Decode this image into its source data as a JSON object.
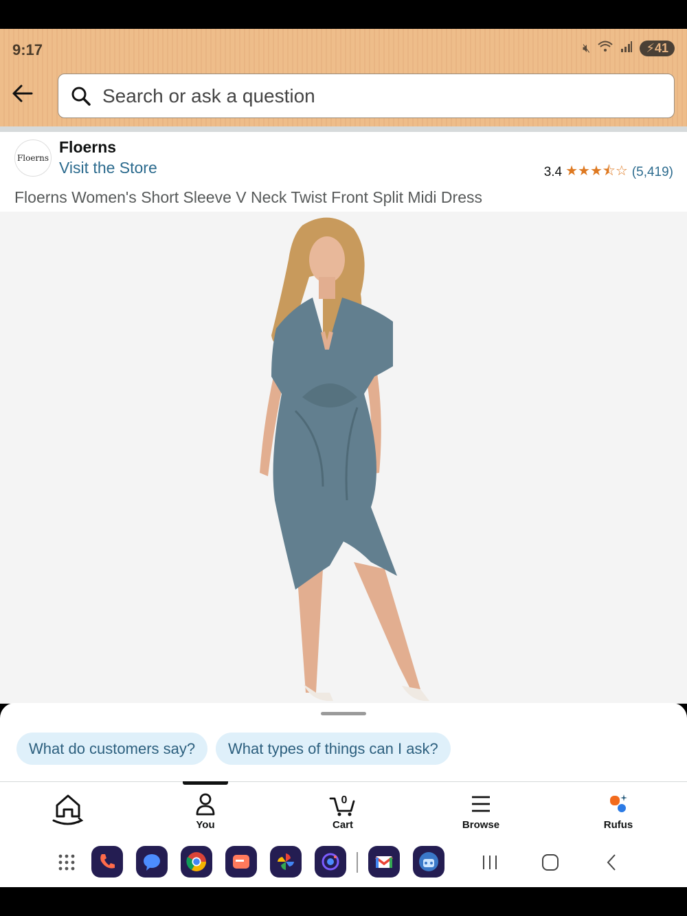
{
  "status_bar": {
    "time": "9:17",
    "battery": "41"
  },
  "search": {
    "placeholder": "Search or ask a question"
  },
  "brand": {
    "logo_text": "Floerns",
    "name": "Floerns",
    "visit_store": "Visit the Store"
  },
  "rating": {
    "value": "3.4",
    "stars": 3.5,
    "count": "(5,419)"
  },
  "product": {
    "title": "Floerns Women's Short Sleeve V Neck Twist Front Split Midi Dress",
    "dress_color": "#627f8f"
  },
  "rufus": {
    "chips": [
      "What do customers say?",
      "What types of things can I ask?"
    ]
  },
  "nav": {
    "items": [
      {
        "label": "",
        "icon": "home-icon"
      },
      {
        "label": "You",
        "icon": "person-icon"
      },
      {
        "label": "Cart",
        "icon": "cart-icon",
        "badge": "0"
      },
      {
        "label": "Browse",
        "icon": "menu-icon"
      },
      {
        "label": "Rufus",
        "icon": "rufus-icon"
      }
    ]
  },
  "colors": {
    "accent_link": "#2c6b8e",
    "star": "#de7921",
    "header": "#eebd8a"
  }
}
